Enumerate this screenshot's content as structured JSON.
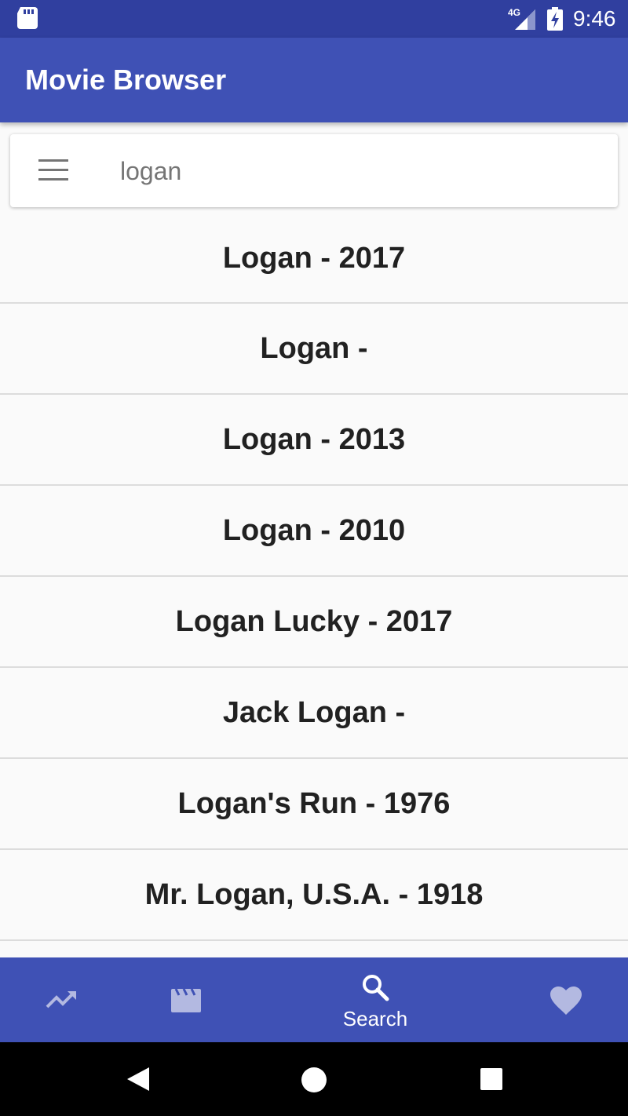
{
  "status_bar": {
    "time": "9:46",
    "network": "4G",
    "icons": [
      "sd-card-icon",
      "cellular-signal-icon",
      "battery-charging-icon"
    ]
  },
  "app_bar": {
    "title": "Movie Browser"
  },
  "search": {
    "value": "logan",
    "menu_icon": "menu-icon"
  },
  "results": [
    {
      "title": "Logan - 2017"
    },
    {
      "title": "Logan -"
    },
    {
      "title": "Logan - 2013"
    },
    {
      "title": "Logan - 2010"
    },
    {
      "title": "Logan Lucky - 2017"
    },
    {
      "title": "Jack Logan -"
    },
    {
      "title": "Logan's Run - 1976"
    },
    {
      "title": "Mr. Logan, U.S.A. - 1918"
    }
  ],
  "bottom_nav": {
    "items": [
      {
        "icon": "trending-icon",
        "label": "",
        "active": false
      },
      {
        "icon": "movie-clapper-icon",
        "label": "",
        "active": false
      },
      {
        "icon": "search-icon",
        "label": "Search",
        "active": true
      },
      {
        "icon": "heart-icon",
        "label": "",
        "active": false
      }
    ]
  },
  "system_nav": {
    "icons": [
      "back-icon",
      "home-icon",
      "recents-icon"
    ]
  },
  "colors": {
    "primary": "#3f51b5",
    "primary_dark": "#303f9f",
    "background": "#fafafa",
    "inactive_icon": "#b3b9e1"
  }
}
